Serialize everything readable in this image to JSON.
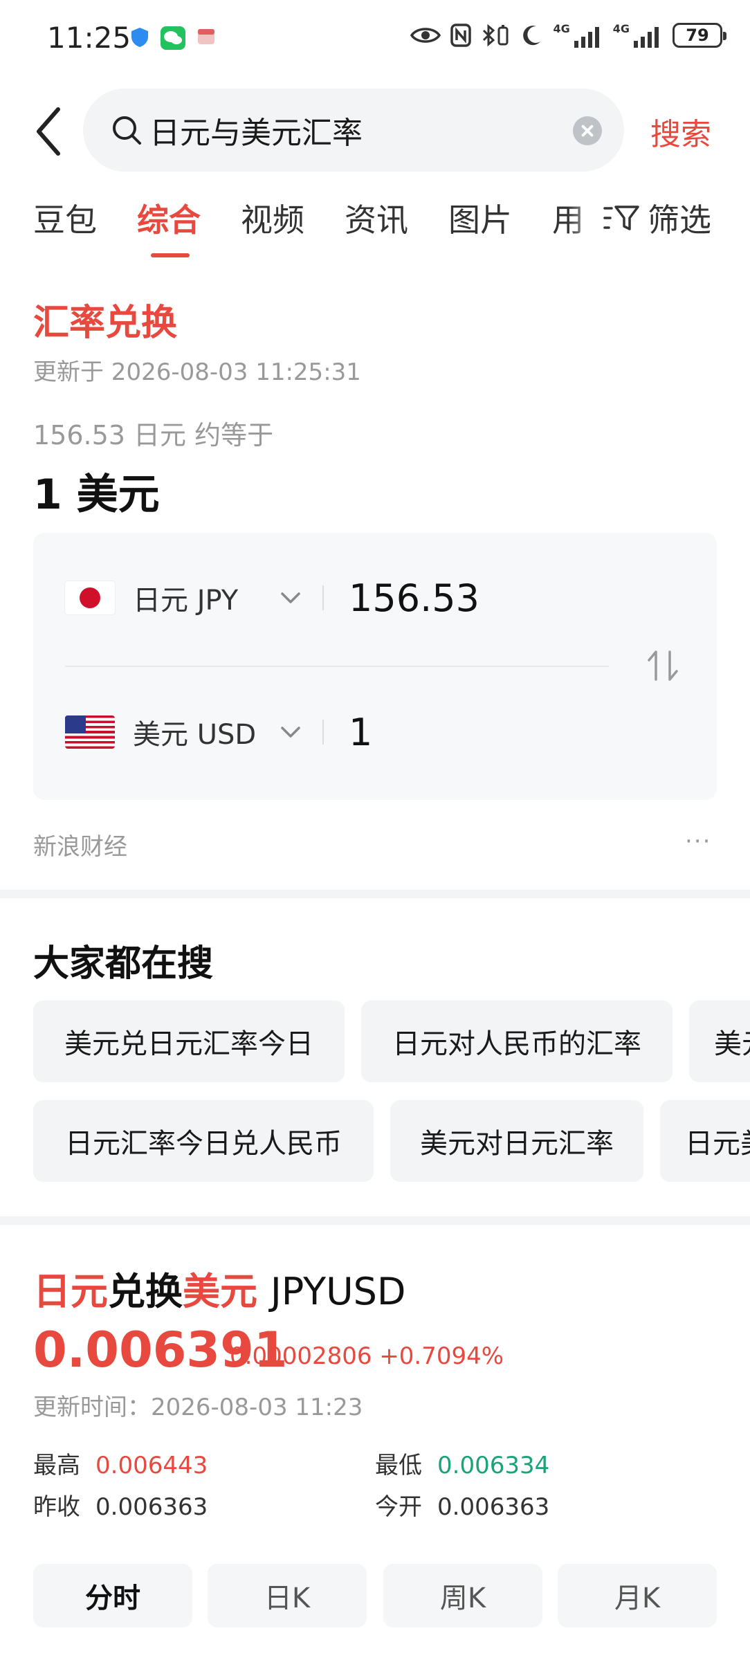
{
  "status_bar": {
    "time": "11:25",
    "signal1": "4G",
    "signal2": "4G",
    "battery": "79"
  },
  "search": {
    "query": "日元与美元汇率",
    "button": "搜索"
  },
  "tabs": [
    {
      "label": "豆包"
    },
    {
      "label": "综合"
    },
    {
      "label": "视频"
    },
    {
      "label": "资讯"
    },
    {
      "label": "图片"
    },
    {
      "label": "用"
    }
  ],
  "filter_label": "筛选",
  "exchange": {
    "title": "汇率兑换",
    "updated": "更新于 2026-08-03 11:25:31",
    "approx": "156.53 日元 约等于",
    "result": "1 美元",
    "from_currency": "日元 JPY",
    "from_amount": "156.53",
    "to_currency": "美元 USD",
    "to_amount": "1",
    "source": "新浪财经",
    "more": "···"
  },
  "hot_searches": {
    "title": "大家都在搜",
    "row1": [
      "美元兑日元汇率今日",
      "日元对人民币的汇率",
      "美元"
    ],
    "row2": [
      "日元汇率今日兑人民币",
      "美元对日元汇率",
      "日元美"
    ]
  },
  "quote": {
    "title_part1": "日元",
    "title_part2": "兑换",
    "title_part3": "美元",
    "code": "JPYUSD",
    "price": "0.006391",
    "change": "0.00002806 +0.7094%",
    "updated": "更新时间：2026-08-03 11:23",
    "high_label": "最高",
    "high_value": "0.006443",
    "low_label": "最低",
    "low_value": "0.006334",
    "prev_close_label": "昨收",
    "prev_close_value": "0.006363",
    "open_label": "今开",
    "open_value": "0.006363"
  },
  "chart_tabs": [
    "分时",
    "日K",
    "周K",
    "月K"
  ],
  "colors": {
    "accent": "#e8493f",
    "down": "#1aa37a"
  }
}
